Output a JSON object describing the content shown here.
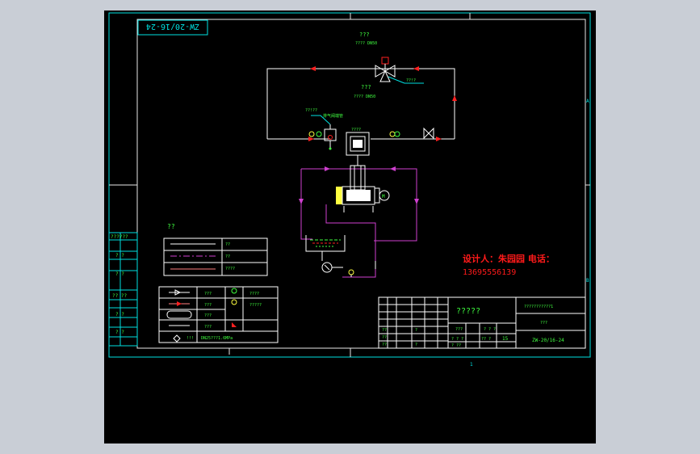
{
  "drawing": {
    "code_rotated": "ZW-20/16-24",
    "code_titleblock": "ZW-20/16-24",
    "page_no": "1",
    "sheet_count": "15",
    "title_placeholder": "?????",
    "title_right": "???????????1",
    "title_right2": "???"
  },
  "designer": {
    "line1": "设计人：朱园园 电话：",
    "line2": "13695556139"
  },
  "schematic": {
    "valve_label_top": "???",
    "valve_label_top2": "???? DN50",
    "valve_label_side": "??!?",
    "valve_label_mid": "???",
    "valve_label_mid2": "???? DN50",
    "tank_label": "??!??",
    "tank_label2": "排气阀端管",
    "pump_label": "????"
  },
  "legend": {
    "title": "??",
    "lines": [
      "??",
      "??",
      "????"
    ],
    "symbols": [
      {
        "a": "???",
        "b": "????"
      },
      {
        "a": "???",
        "b": "?????"
      },
      {
        "a": "???",
        "b": ""
      },
      {
        "a": "???",
        "b": ""
      },
      {
        "a": "!!!",
        "b": "DN25???1.6MPa"
      }
    ]
  },
  "left_labels": [
    "??????",
    "? ?",
    "? ?",
    "?? ??",
    "? ?",
    "? ?"
  ],
  "titleblock": {
    "cells": [
      "??",
      "??",
      "??",
      "?",
      "?",
      "???",
      "? ? ?",
      "? ? ?",
      "?? ?",
      "? ??"
    ]
  },
  "colors": {
    "frame": "#00e0e0",
    "geometry": "#ffffff",
    "pipe_red": "#ff2020",
    "pipe_magenta": "#d040d0",
    "label_green": "#40ff40",
    "label_yellow": "#ffff40",
    "designer_red": "#ff1a1a"
  }
}
